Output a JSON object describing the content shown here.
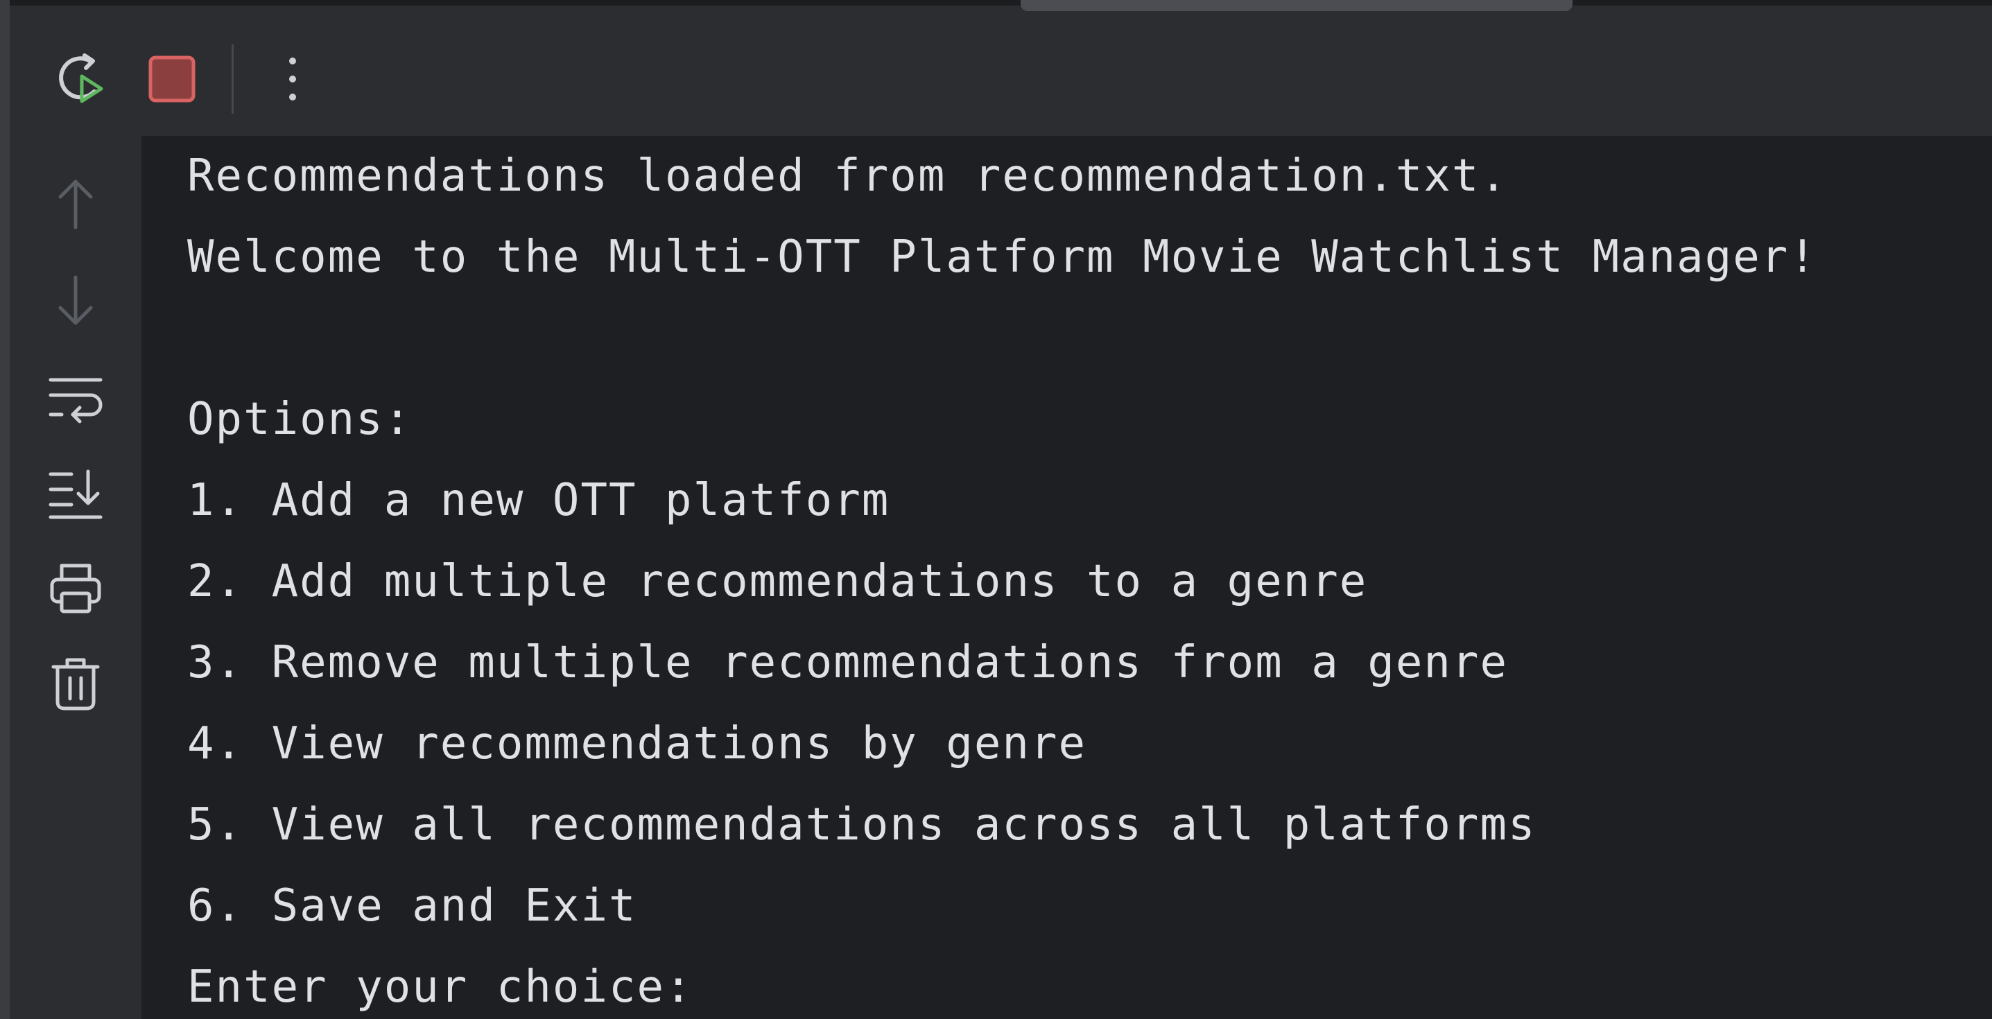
{
  "toolbar": {
    "buttons": [
      {
        "icon": "rerun-icon",
        "tooltip": ""
      },
      {
        "icon": "stop-icon",
        "tooltip": ""
      },
      {
        "icon": "more-options-icon",
        "tooltip": ""
      }
    ]
  },
  "gutter": {
    "icons": [
      "up-arrow-icon",
      "down-arrow-icon",
      "soft-wrap-icon",
      "scroll-to-end-icon",
      "print-icon",
      "trash-icon"
    ]
  },
  "console": {
    "lines": [
      "Recommendations loaded from recommendation.txt.",
      "Welcome to the Multi-OTT Platform Movie Watchlist Manager!",
      "",
      "Options:",
      "1. Add a new OTT platform",
      "2. Add multiple recommendations to a genre",
      "3. Remove multiple recommendations from a genre",
      "4. View recommendations by genre",
      "5. View all recommendations across all platforms",
      "6. Save and Exit",
      "Enter your choice:"
    ]
  },
  "colors": {
    "toolbar_bg": "#2b2d30",
    "console_bg": "#1e1f22",
    "text": "#dfe1e5",
    "stop_red": "#c75450",
    "run_green": "#5fb85f",
    "icon_gray": "#ced0d6",
    "icon_disabled": "#5a5d63"
  }
}
